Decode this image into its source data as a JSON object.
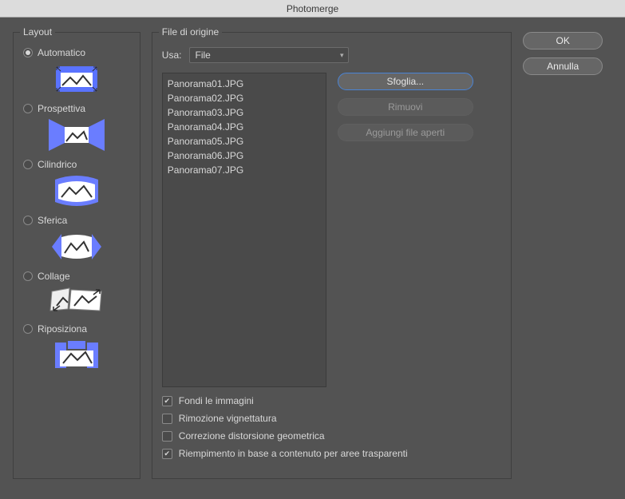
{
  "title": "Photomerge",
  "layout": {
    "legend": "Layout",
    "options": [
      {
        "label": "Automatico",
        "selected": true
      },
      {
        "label": "Prospettiva",
        "selected": false
      },
      {
        "label": "Cilindrico",
        "selected": false
      },
      {
        "label": "Sferica",
        "selected": false
      },
      {
        "label": "Collage",
        "selected": false
      },
      {
        "label": "Riposiziona",
        "selected": false
      }
    ]
  },
  "source": {
    "legend": "File di origine",
    "use_label": "Usa:",
    "use_value": "File",
    "files": [
      "Panorama01.JPG",
      "Panorama02.JPG",
      "Panorama03.JPG",
      "Panorama04.JPG",
      "Panorama05.JPG",
      "Panorama06.JPG",
      "Panorama07.JPG"
    ],
    "browse": "Sfoglia...",
    "remove": "Rimuovi",
    "add_open": "Aggiungi file aperti",
    "opts": {
      "blend": {
        "label": "Fondi le immagini",
        "checked": true
      },
      "vignette": {
        "label": "Rimozione vignettatura",
        "checked": false
      },
      "geo": {
        "label": "Correzione distorsione geometrica",
        "checked": false
      },
      "fill": {
        "label": "Riempimento in base a contenuto per aree trasparenti",
        "checked": true
      }
    }
  },
  "buttons": {
    "ok": "OK",
    "cancel": "Annulla"
  }
}
